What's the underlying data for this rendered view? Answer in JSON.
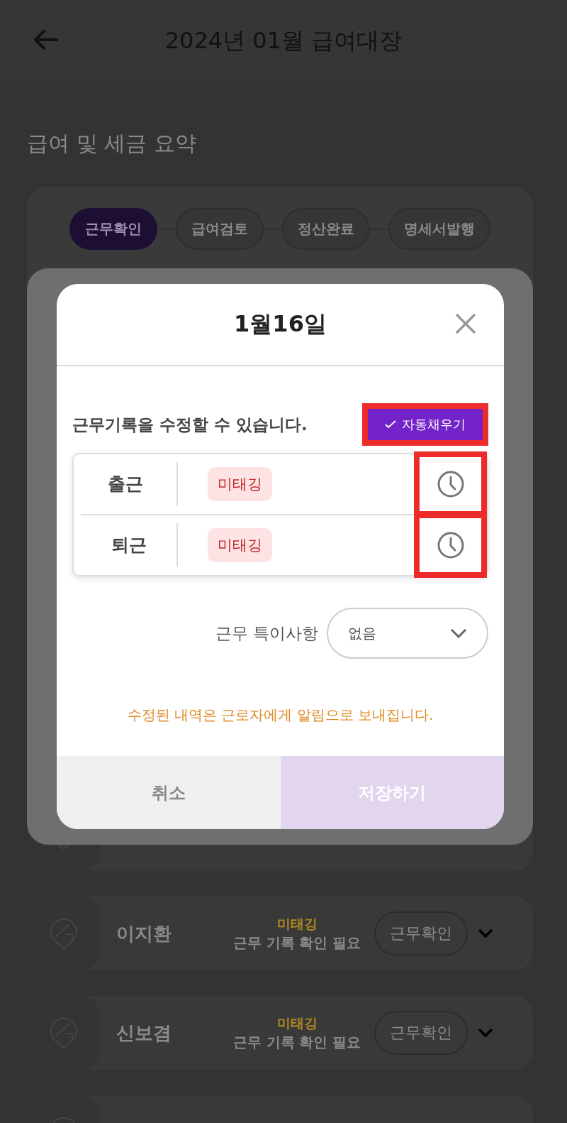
{
  "header": {
    "title": "2024년 01월 급여대장"
  },
  "section_title": "급여 및 세금 요약",
  "steps": [
    {
      "label": "근무확인",
      "selected": true
    },
    {
      "label": "급여검토",
      "selected": false
    },
    {
      "label": "정산완료",
      "selected": false
    },
    {
      "label": "명세서발행",
      "selected": false
    }
  ],
  "employees": [
    {
      "name": "이지환",
      "status": "미태깅",
      "note": "근무 기록 확인 필요",
      "action": "근무확인"
    },
    {
      "name": "신보겸",
      "status": "미태깅",
      "note": "근무 기록 확인 필요",
      "action": "근무확인"
    }
  ],
  "dialog": {
    "title": "1월16일",
    "message": "근무기록을 수정할 수 있습니다.",
    "autofill": {
      "label": "자동채우기",
      "highlighted": true
    },
    "records": [
      {
        "label": "출근",
        "status": "미태깅",
        "highlighted": true
      },
      {
        "label": "퇴근",
        "status": "미태깅",
        "highlighted": true
      }
    ],
    "remark": {
      "label": "근무 특이사항",
      "value": "없음"
    },
    "notice": "수정된 내역은 근로자에게 알림으로 보내집니다.",
    "buttons": [
      {
        "label": "취소",
        "kind": "cancel"
      },
      {
        "label": "저장하기",
        "kind": "save"
      }
    ]
  }
}
